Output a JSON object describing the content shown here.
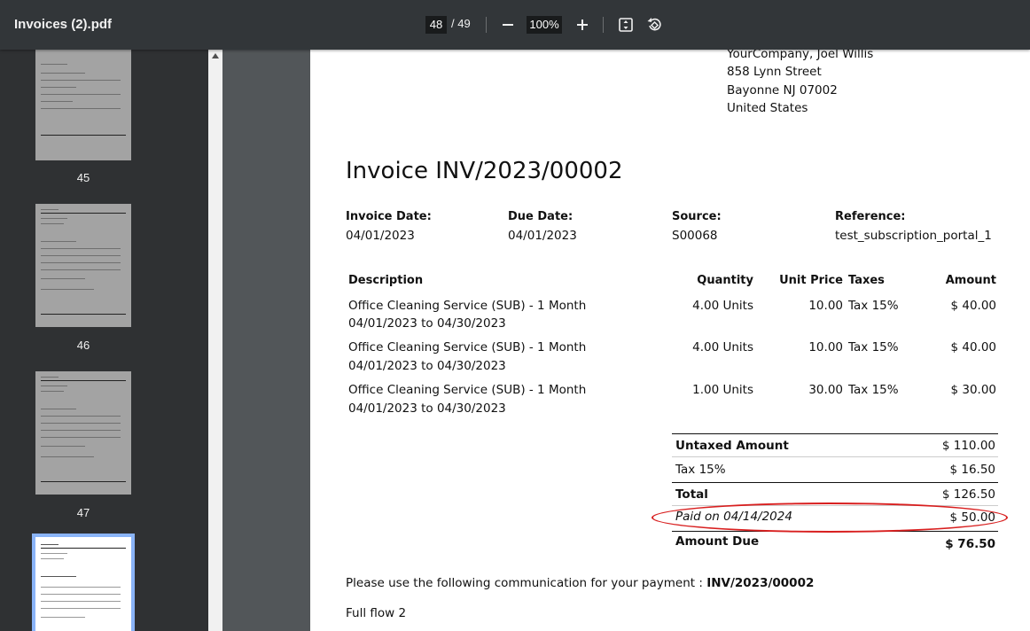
{
  "toolbar": {
    "title": "Invoices (2).pdf",
    "current_page": "48",
    "total_pages": "/ 49",
    "zoom": "100%",
    "icons": [
      "minus-icon",
      "plus-icon",
      "fit-page-icon",
      "rotate-icon"
    ]
  },
  "sidebar": {
    "thumbnails": [
      {
        "label": "45"
      },
      {
        "label": "46"
      },
      {
        "label": "47"
      },
      {
        "label": ""
      }
    ]
  },
  "invoice": {
    "company_lines": [
      "YourCompany, Joel Willis",
      "858 Lynn Street",
      "Bayonne NJ 07002",
      "United States"
    ],
    "title": "Invoice INV/2023/00002",
    "meta": [
      {
        "label": "Invoice Date:",
        "value": "04/01/2023"
      },
      {
        "label": "Due Date:",
        "value": "04/01/2023"
      },
      {
        "label": "Source:",
        "value": "S00068"
      },
      {
        "label": "Reference:",
        "value": "test_subscription_portal_1"
      }
    ],
    "columns": [
      "Description",
      "Quantity",
      "Unit Price",
      "Taxes",
      "Amount"
    ],
    "lines": [
      {
        "desc1": "Office Cleaning Service (SUB) - 1 Month",
        "desc2": "04/01/2023 to 04/30/2023",
        "qty": "4.00 Units",
        "price": "10.00",
        "tax": "Tax 15%",
        "amount": "$ 40.00"
      },
      {
        "desc1": "Office Cleaning Service (SUB) - 1 Month",
        "desc2": "04/01/2023 to 04/30/2023",
        "qty": "4.00 Units",
        "price": "10.00",
        "tax": "Tax 15%",
        "amount": "$ 40.00"
      },
      {
        "desc1": "Office Cleaning Service (SUB) - 1 Month",
        "desc2": "04/01/2023 to 04/30/2023",
        "qty": "1.00 Units",
        "price": "30.00",
        "tax": "Tax 15%",
        "amount": "$ 30.00"
      }
    ],
    "totals": {
      "untaxed_label": "Untaxed Amount",
      "untaxed": "$ 110.00",
      "tax_label": "Tax 15%",
      "tax": "$ 16.50",
      "total_label": "Total",
      "total": "$ 126.50",
      "paid_label": "Paid on 04/14/2024",
      "paid": "$ 50.00",
      "due_label": "Amount Due",
      "due": "$ 76.50"
    },
    "communication_prefix": "Please use the following communication for your payment : ",
    "communication_ref": "INV/2023/00002",
    "note": "Full flow 2",
    "annotation_color": "#d81f1f"
  }
}
